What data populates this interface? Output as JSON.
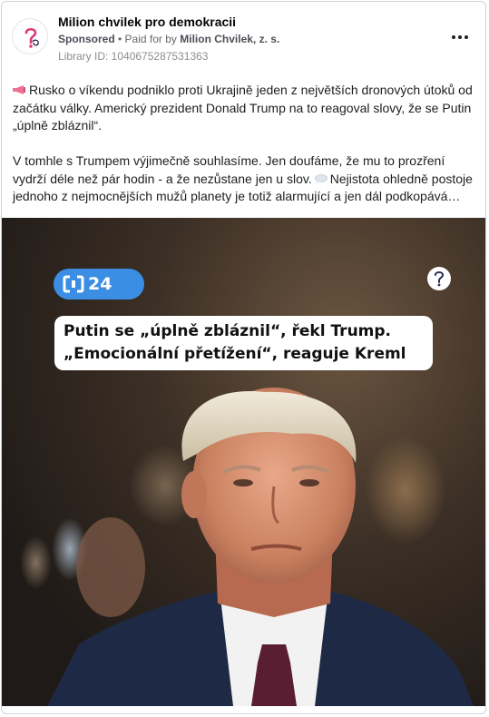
{
  "post": {
    "page_name": "Milion chvilek pro demokracii",
    "sponsored_label": "Sponsored",
    "paid_for_prefix": " • Paid for by ",
    "paid_for_name": "Milion Chvilek, z. s.",
    "library_id": "Library ID: 1040675287531363",
    "more_icon": "more-options-icon",
    "body": {
      "paragraph1": "Rusko o víkendu podniklo proti Ukrajině jeden z největších dronových útoků od začátku války. Americký prezident Donald Trump na to reagoval slovy, že se Putin „úplně zbláznil“.",
      "paragraph2_part1": "V tomhle s Trumpem výjimečně souhlasíme. Jen doufáme, že mu to prozření vydrží déle než pár hodin - a že nezůstane jen u slov.",
      "paragraph2_part2": "Nejistota ohledně postoje jednoho z nejmocnějších mužů planety je totiž alarmující a jen dál podkopává…"
    }
  },
  "media": {
    "broadcaster_label": "24",
    "headline_line1": "Putin se „úplně zbláznil“, řekl Trump.",
    "headline_line2": "„Emocionální přetížení“, reaguje Kreml"
  },
  "colors": {
    "accent_blue": "#3b8ee4",
    "brand_pink": "#e0357a",
    "brand_navy": "#2b2d52"
  }
}
